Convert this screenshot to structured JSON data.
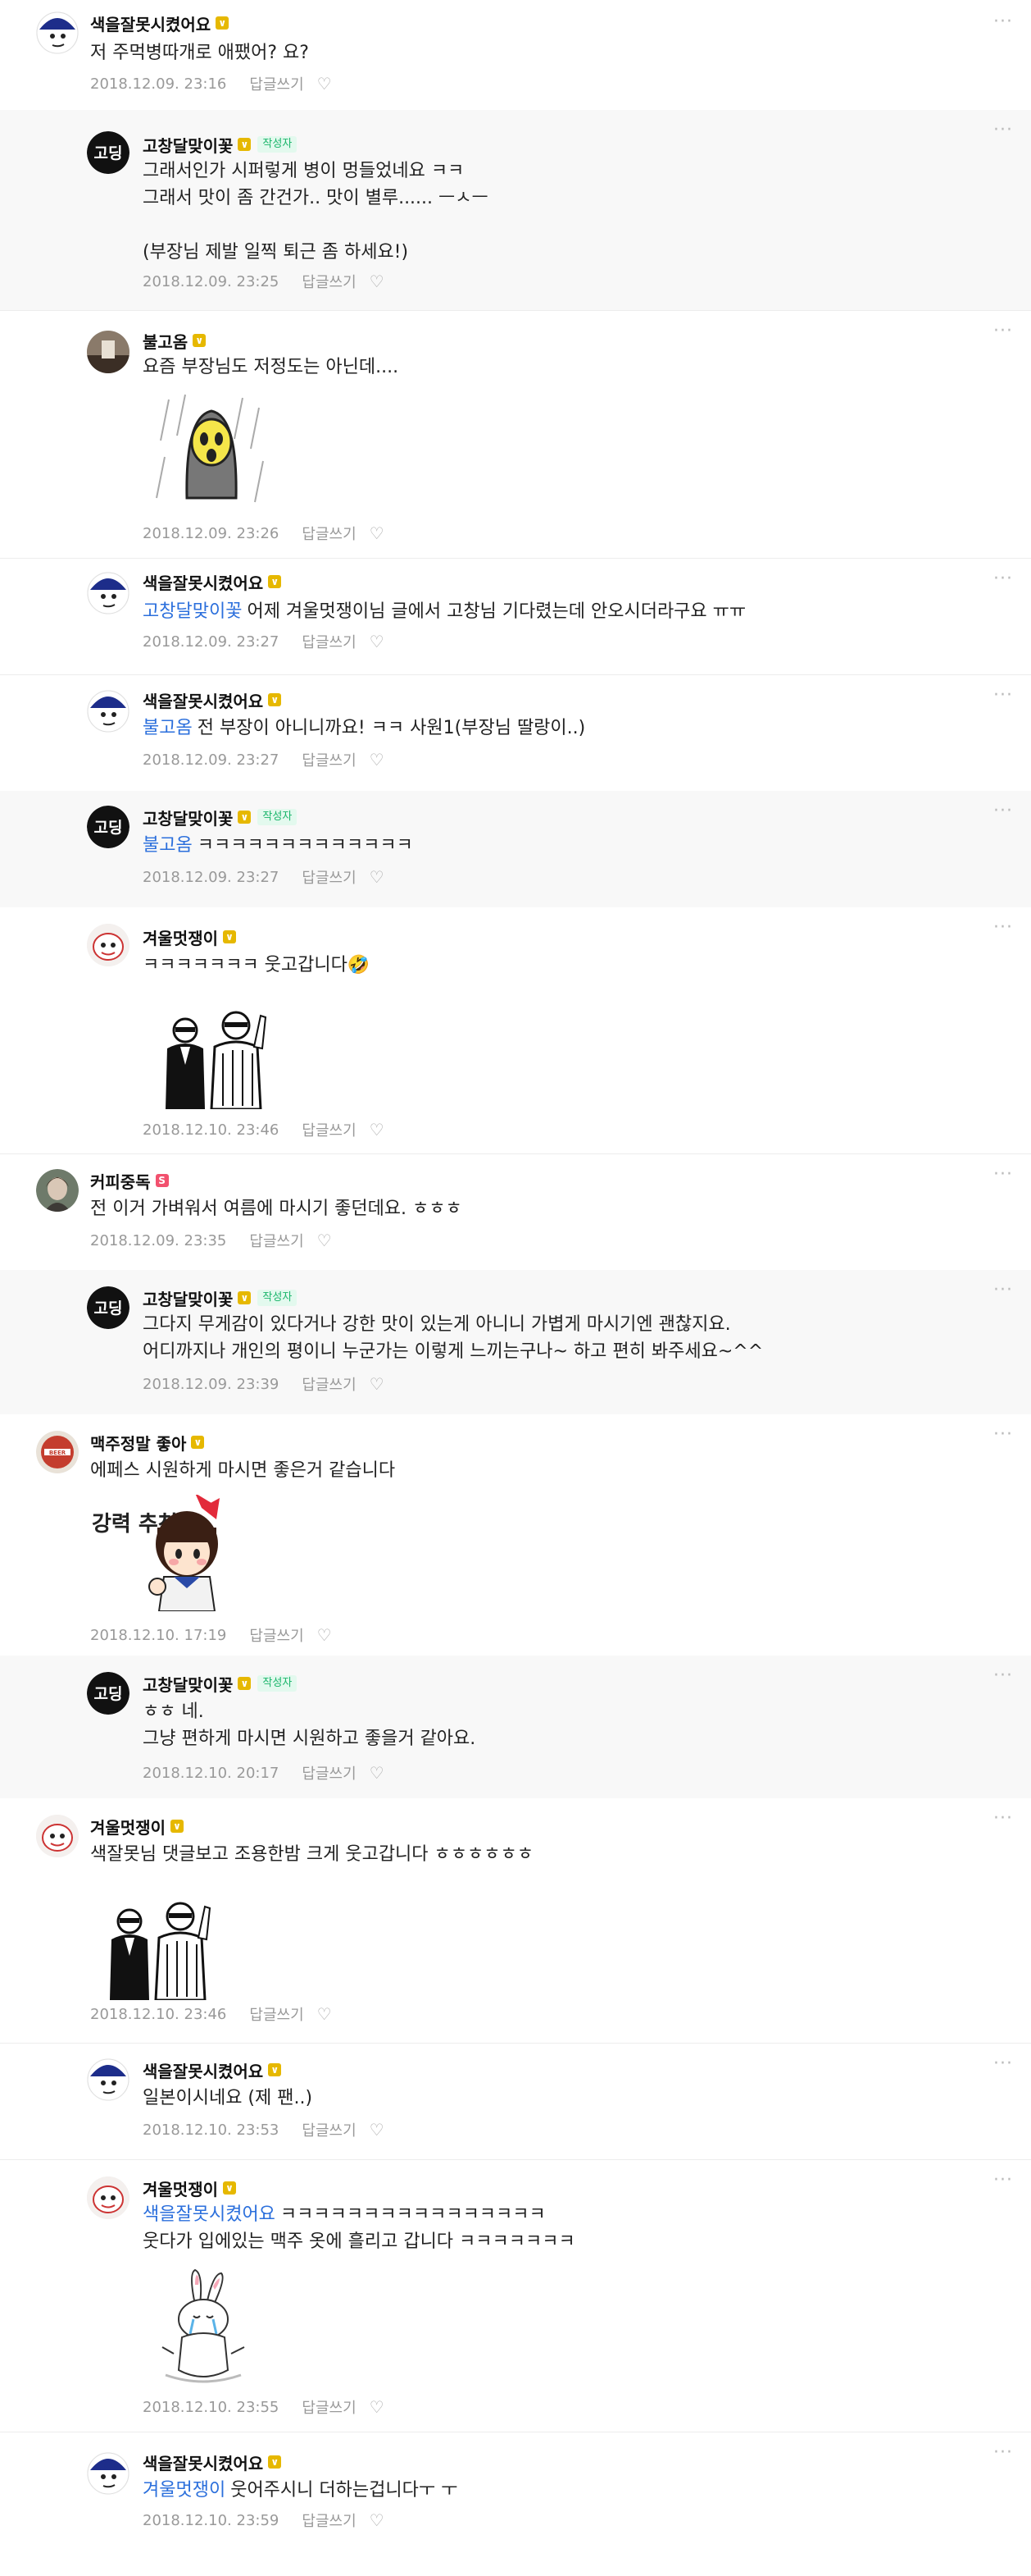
{
  "meta": {
    "reply_label": "답글쓰기",
    "author_badge": "작성자",
    "more_label": "···",
    "heart_symbol": "♡"
  },
  "comments": [
    {
      "nick": "색을잘못시켰어요",
      "lines": [
        "저 주먹병따개로 애팼어? 요?"
      ],
      "date": "2018.12.09. 23:16"
    },
    {
      "nick": "고창달맞이꽃",
      "lines": [
        "그래서인가 시퍼렇게 병이 멍들었네요 ㅋㅋ",
        "그래서 맛이 좀 간건가.. 맛이 별루...... ㅡㅅㅡ",
        "",
        "(부장님 제발 일찍 퇴근 좀 하세요!)"
      ],
      "date": "2018.12.09. 23:25"
    },
    {
      "nick": "불고옴",
      "lines": [
        "요즘 부장님도 저정도는 아닌데...."
      ],
      "date": "2018.12.09. 23:26"
    },
    {
      "nick": "색을잘못시켰어요",
      "tag": "고창달맞이꽃",
      "lines": [
        "어제 겨울멋쟁이님 글에서 고창님 기다렸는데 안오시더라구요 ㅠㅠ"
      ],
      "date": "2018.12.09. 23:27"
    },
    {
      "nick": "색을잘못시켰어요",
      "tag": "불고옴",
      "lines": [
        "전 부장이 아니니까요! ㅋㅋ 사원1(부장님 딸랑이..)"
      ],
      "date": "2018.12.09. 23:27"
    },
    {
      "nick": "고창달맞이꽃",
      "tag": "불고옴",
      "lines": [
        "ㅋㅋㅋㅋㅋㅋㅋㅋㅋㅋㅋㅋㅋ"
      ],
      "date": "2018.12.09. 23:27"
    },
    {
      "nick": "겨울멋쟁이",
      "lines": [
        "ㅋㅋㅋㅋㅋㅋㅋ 웃고갑니다🤣"
      ],
      "date": "2018.12.10. 23:46"
    },
    {
      "nick": "커피중독",
      "lines": [
        "전 이거 가벼워서 여름에 마시기 좋던데요. ㅎㅎㅎ"
      ],
      "date": "2018.12.09. 23:35"
    },
    {
      "nick": "고창달맞이꽃",
      "lines": [
        "그다지 무게감이 있다거나 강한 맛이 있는게 아니니 가볍게 마시기엔 괜찮지요.",
        "어디까지나 개인의 평이니 누군가는 이렇게 느끼는구나~ 하고 편히 봐주세요~^^"
      ],
      "date": "2018.12.09. 23:39"
    },
    {
      "nick": "맥주정말 좋아",
      "lines": [
        "에페스 시원하게 마시면 좋은거 같습니다"
      ],
      "date": "2018.12.10. 17:19",
      "sticker_text": "강력 추천"
    },
    {
      "nick": "고창달맞이꽃",
      "lines": [
        "ㅎㅎ 네.",
        "그냥 편하게 마시면 시원하고 좋을거 같아요."
      ],
      "date": "2018.12.10. 20:17"
    },
    {
      "nick": "겨울멋쟁이",
      "lines": [
        "색잘못님 댓글보고 조용한밤 크게 웃고갑니다 ㅎㅎㅎㅎㅎㅎ"
      ],
      "date": "2018.12.10. 23:46"
    },
    {
      "nick": "색을잘못시켰어요",
      "lines": [
        "일본이시네요 (제 팬..)"
      ],
      "date": "2018.12.10. 23:53"
    },
    {
      "nick": "겨울멋쟁이",
      "tag": "색을잘못시켰어요",
      "lines": [
        "ㅋㅋㅋㅋㅋㅋㅋㅋㅋㅋㅋㅋㅋㅋㅋㅋ",
        "웃다가 입에있는 맥주 옷에 흘리고 갑니다 ㅋㅋㅋㅋㅋㅋㅋ"
      ],
      "date": "2018.12.10. 23:55"
    },
    {
      "nick": "색을잘못시켰어요",
      "tag": "겨울멋쟁이",
      "lines": [
        "웃어주시니 더하는겁니다ㅜ ㅜ"
      ],
      "date": "2018.12.10. 23:59"
    }
  ],
  "colors": {
    "mention": "#2b6fdc",
    "author_badge_bg": "#e3f9ee",
    "author_badge_text": "#19b56a",
    "level_badge": "#e6b800",
    "highlight_bg": "#f8f8f8"
  }
}
